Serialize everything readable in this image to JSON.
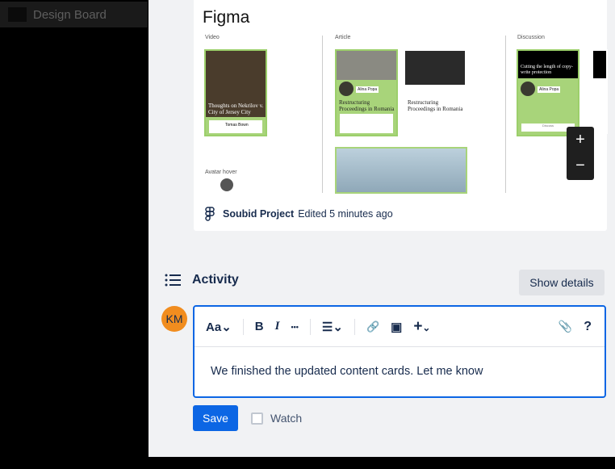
{
  "sidebar": {
    "board_title": "Design Board"
  },
  "preview": {
    "app_title": "Figma",
    "sections": {
      "video": "Video",
      "article": "Article",
      "discussion": "Discussion",
      "avatar_hover": "Avatar hover"
    },
    "video_card": {
      "title": "Thoughts on Nekrilov v. City of Jersey City",
      "author": "Tomas Bown"
    },
    "article_card": {
      "title": "Restructuring Proceedings in Romania",
      "author": "Alina Popa"
    },
    "discussion_card": {
      "title": "Cutting the length of copy-write protection",
      "author": "Alina Popa",
      "button": "Discuss"
    },
    "project_name": "Soubid Project",
    "edited": "Edited 5 minutes ago",
    "zoom_in": "+",
    "zoom_out": "−"
  },
  "activity": {
    "title": "Activity",
    "show_details": "Show details"
  },
  "comment": {
    "avatar_initials": "KM",
    "toolbar": {
      "text_style": "Aa",
      "bold": "B",
      "italic": "I",
      "more": "•••",
      "list": "☰",
      "link": "🔗",
      "image": "▣",
      "insert": "+",
      "attach": "📎",
      "help": "?"
    },
    "text": "We finished the updated content cards. Let me know",
    "save": "Save",
    "watch": "Watch"
  }
}
